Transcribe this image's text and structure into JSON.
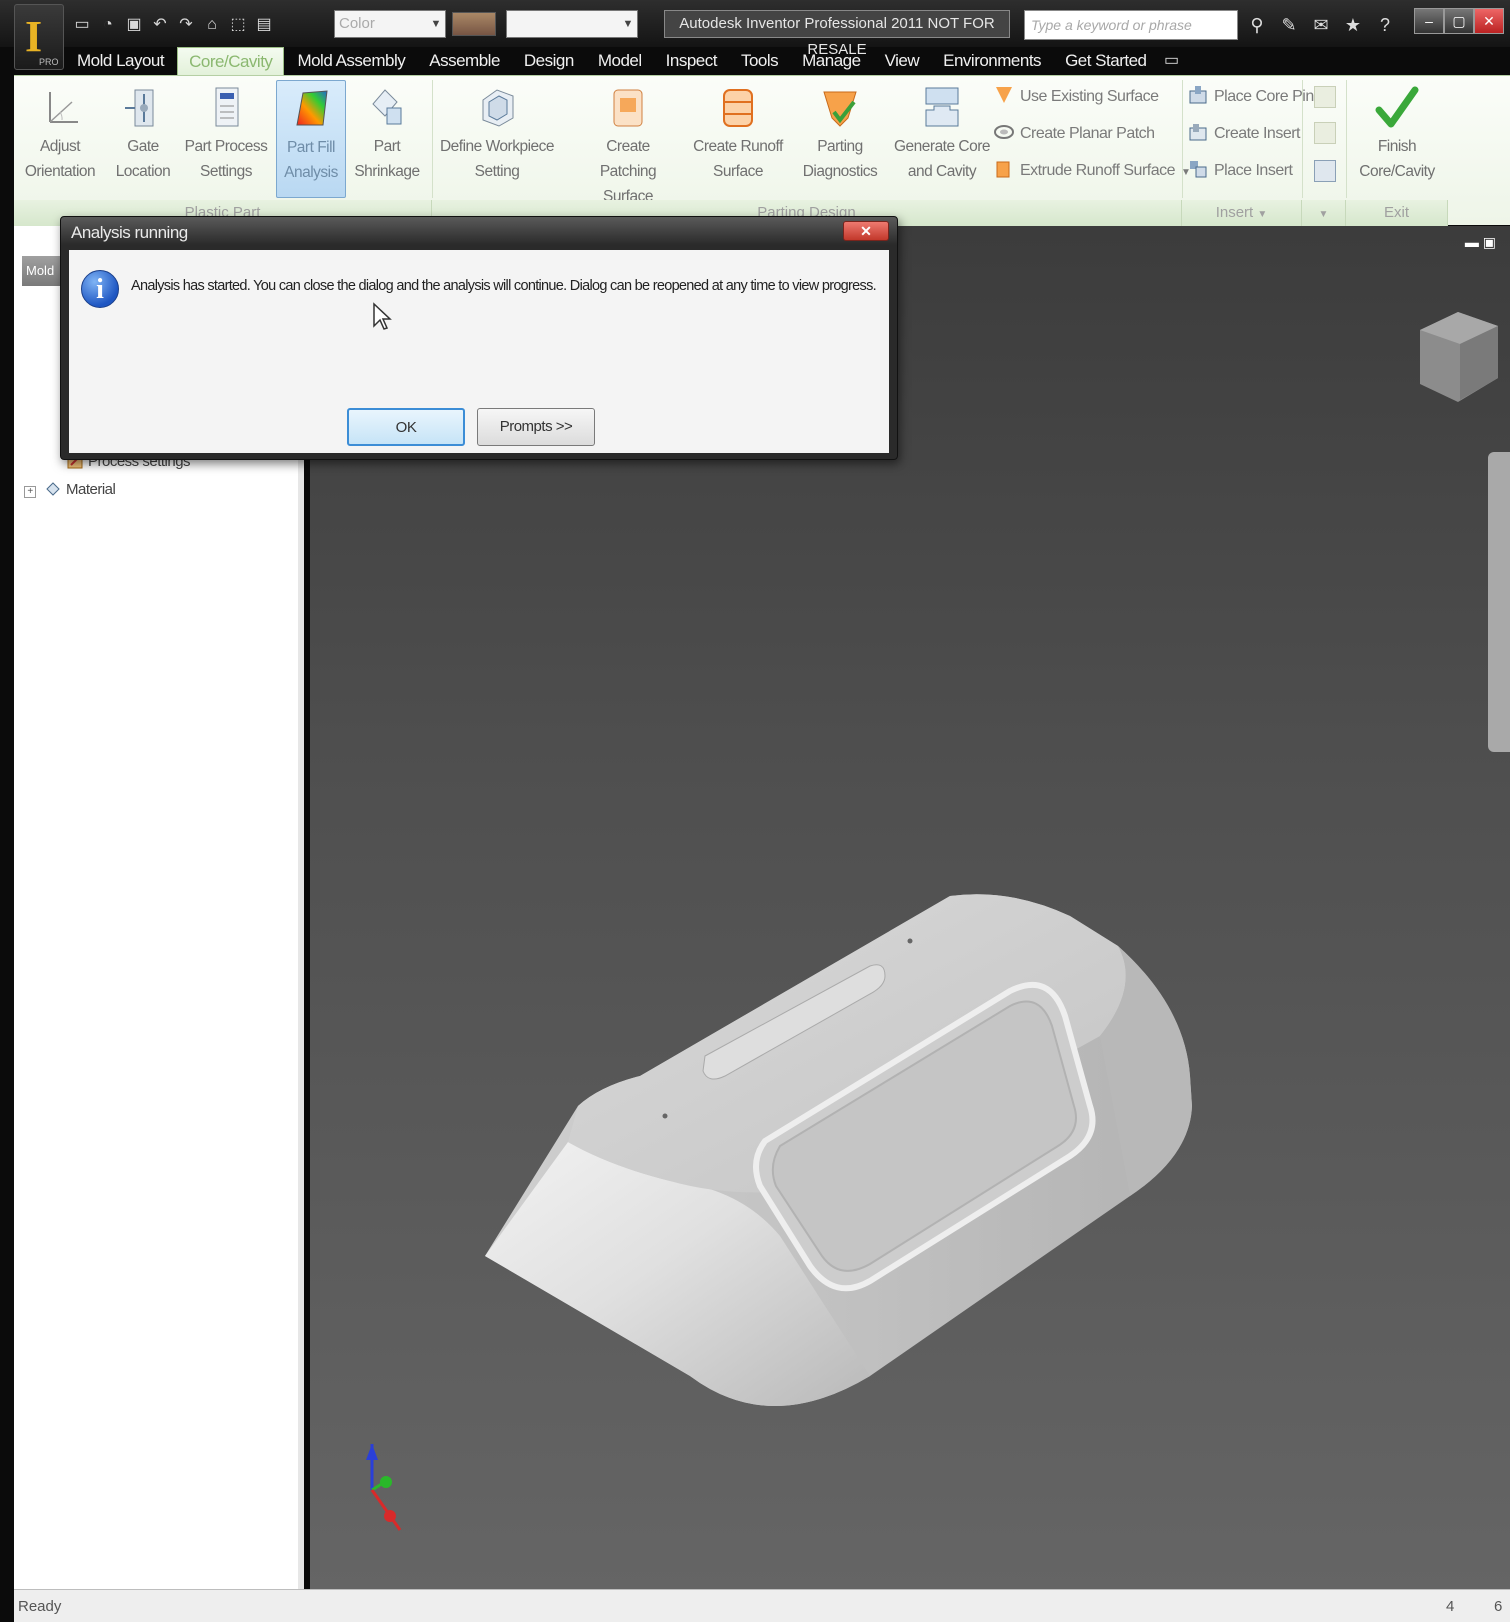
{
  "app": {
    "title": "Autodesk Inventor Professional 2011    NOT FOR RESALE",
    "logo_letter": "I",
    "logo_edition": "PRO",
    "search_placeholder": "Type a keyword or phrase",
    "color_combo": "Color"
  },
  "tabs": [
    {
      "label": "Mold Layout"
    },
    {
      "label": "Core/Cavity"
    },
    {
      "label": "Mold Assembly"
    },
    {
      "label": "Assemble"
    },
    {
      "label": "Design"
    },
    {
      "label": "Model"
    },
    {
      "label": "Inspect"
    },
    {
      "label": "Tools"
    },
    {
      "label": "Manage"
    },
    {
      "label": "View"
    },
    {
      "label": "Environments"
    },
    {
      "label": "Get Started"
    }
  ],
  "ribbon": {
    "plastic_part": {
      "group": "Plastic Part",
      "adjust_orientation": [
        "Adjust",
        "Orientation"
      ],
      "gate_location": [
        "Gate",
        "Location"
      ],
      "part_process_settings": [
        "Part Process",
        "Settings"
      ],
      "part_fill_analysis": [
        "Part Fill",
        "Analysis"
      ],
      "part_shrinkage": [
        "Part",
        "Shrinkage"
      ]
    },
    "parting_design": {
      "group": "Parting Design",
      "define_workpiece": [
        "Define Workpiece",
        "Setting"
      ],
      "create_patching": [
        "Create",
        "Patching Surface"
      ],
      "create_runoff": [
        "Create Runoff",
        "Surface"
      ],
      "parting_diagnostics": [
        "Parting",
        "Diagnostics"
      ],
      "generate_core": [
        "Generate Core",
        "and Cavity"
      ],
      "use_existing_surface": "Use Existing Surface",
      "create_planar_patch": "Create Planar Patch",
      "extrude_runoff_surface": "Extrude Runoff Surface"
    },
    "insert": {
      "group": "Insert",
      "place_core_pin": "Place Core Pin",
      "create_insert": "Create Insert",
      "place_insert": "Place Insert"
    },
    "exit": {
      "group": "Exit",
      "finish": [
        "Finish",
        "Core/Cavity"
      ]
    }
  },
  "browser": {
    "header": "Mold",
    "items": [
      {
        "label": "Process settings"
      },
      {
        "label": "Material"
      }
    ]
  },
  "dialog": {
    "title": "Analysis running",
    "message": "Analysis has started. You can close the dialog and the analysis will continue. Dialog can be reopened at any time to view progress.",
    "ok": "OK",
    "prompts": "Prompts >>"
  },
  "status": {
    "text": "Ready",
    "count1": "4",
    "count2": "6"
  },
  "colors": {
    "accent_tab": "#8bb870",
    "viewport_top": "#3c3c3c",
    "viewport_bottom": "#656565",
    "dialog_default_button": "#3c8dd6"
  },
  "icons": [
    "app-logo-icon",
    "new-icon",
    "open-icon",
    "save-icon",
    "undo-icon",
    "redo-icon",
    "info-icon",
    "checkmark-icon",
    "view-cube-icon",
    "axis-triad-icon"
  ]
}
